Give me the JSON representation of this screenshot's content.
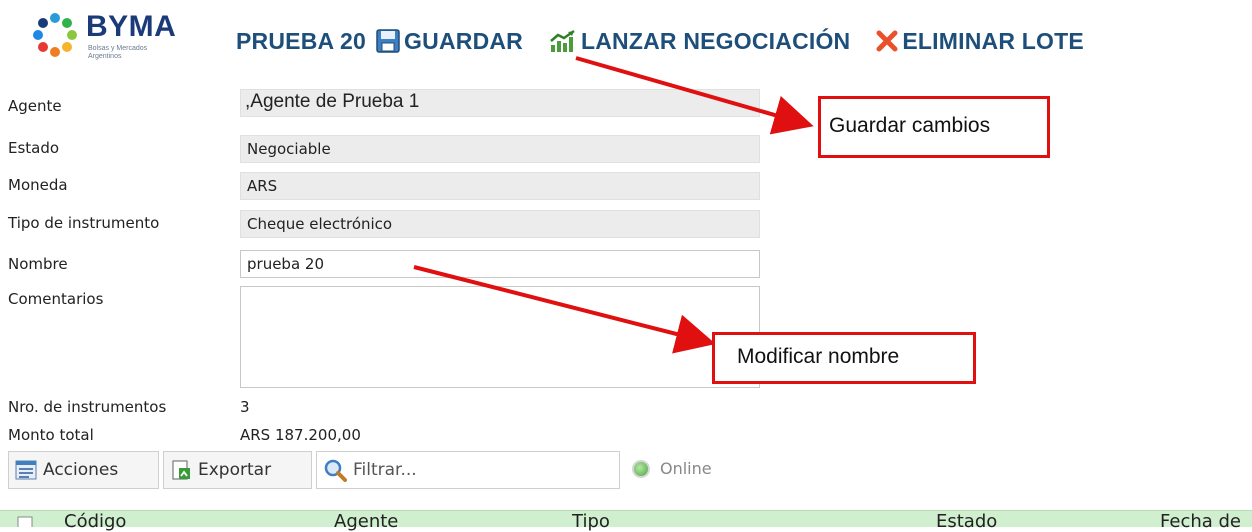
{
  "logo": {
    "name": "BYMA",
    "subtitle": "Bolsas y Mercados Argentinos"
  },
  "toolbar": {
    "lot_title": "PRUEBA 20",
    "save_label": "GUARDAR",
    "launch_label": "LANZAR NEGOCIACIÓN",
    "delete_label": "ELIMINAR LOTE"
  },
  "form": {
    "agent_label": "Agente",
    "agent_value": ",Agente de Prueba 1",
    "status_label": "Estado",
    "status_value": "Negociable",
    "currency_label": "Moneda",
    "currency_value": "ARS",
    "instrument_type_label": "Tipo de instrumento",
    "instrument_type_value": "Cheque electrónico",
    "name_label": "Nombre",
    "name_value": "prueba 20",
    "comments_label": "Comentarios",
    "comments_value": ""
  },
  "summary": {
    "count_label": "Nro. de instrumentos",
    "count_value": "3",
    "total_label": "Monto total",
    "total_value": "ARS 187.200,00"
  },
  "grid_toolbar": {
    "actions_label": "Acciones",
    "export_label": "Exportar",
    "filter_placeholder": "Filtrar...",
    "online_label": "Online"
  },
  "table": {
    "columns": [
      "Código",
      "Agente",
      "Tipo",
      "Estado",
      "Fecha de"
    ]
  },
  "annotations": {
    "save_callout": "Guardar cambios",
    "name_callout": "Modificar nombre"
  },
  "colors": {
    "toolbar_text": "#1e4f7a",
    "callout_border": "#e01010",
    "table_header": "#cfefcf"
  },
  "icons": {
    "save": "floppy-disk-icon",
    "launch": "chart-up-icon",
    "delete": "red-x-icon",
    "actions": "list-icon",
    "export": "export-icon",
    "filter": "magnifier-icon"
  }
}
